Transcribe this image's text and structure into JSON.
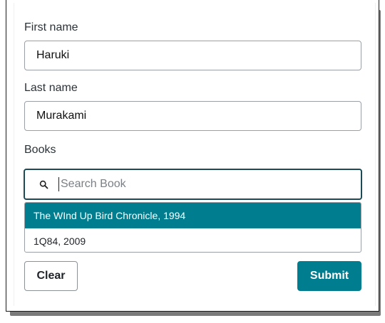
{
  "form": {
    "first_name": {
      "label": "First name",
      "value": "Haruki"
    },
    "last_name": {
      "label": "Last name",
      "value": "Murakami"
    },
    "books": {
      "label": "Books",
      "search_placeholder": "Search Book",
      "search_icon": "search-icon",
      "options": [
        {
          "label": "The WInd Up Bird Chronicle, 1994",
          "highlighted": true
        },
        {
          "label": "1Q84, 2009",
          "highlighted": false
        }
      ]
    },
    "buttons": {
      "clear": "Clear",
      "submit": "Submit"
    }
  },
  "colors": {
    "accent": "#007e8f",
    "focus_border": "#1c4b55"
  }
}
